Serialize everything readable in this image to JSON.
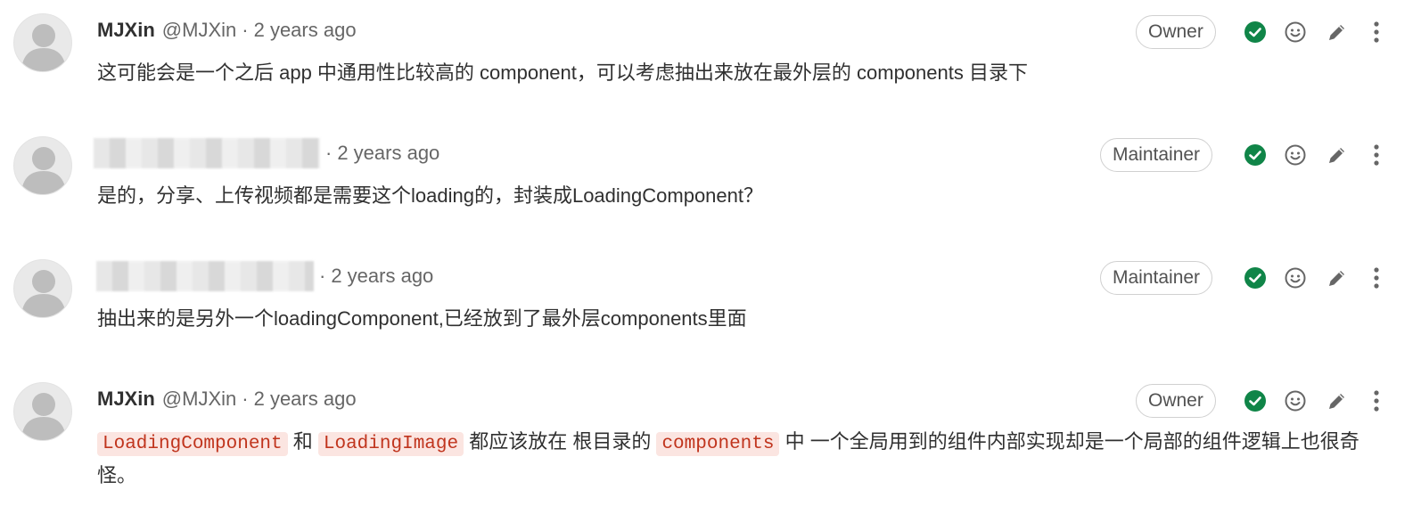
{
  "notes": [
    {
      "author_name": "MJXin",
      "author_handle": "@MJXin",
      "separator": "·",
      "time": "2 years ago",
      "role": "Owner",
      "body": "这可能会是一个之后 app 中通用性比较高的 component，可以考虑抽出来放在最外层的 components 目录下"
    },
    {
      "author_name": "",
      "author_handle": "",
      "separator": "·",
      "time": "2 years ago",
      "role": "Maintainer",
      "body": "是的，分享、上传视频都是需要这个loading的，封装成LoadingComponent？"
    },
    {
      "author_name": "",
      "author_handle": "",
      "separator": "·",
      "time": "2 years ago",
      "role": "Maintainer",
      "body": "抽出来的是另外一个loadingComponent,已经放到了最外层components里面"
    },
    {
      "author_name": "MJXin",
      "author_handle": "@MJXin",
      "separator": "·",
      "time": "2 years ago",
      "role": "Owner",
      "body_parts": {
        "code1": "LoadingComponent",
        "text1": " 和 ",
        "code2": "LoadingImage",
        "text2": " 都应该放在 根目录的 ",
        "code3": "components",
        "text3": " 中 一个全局用到的组件内部实现却是一个局部的组件逻辑上也很奇怪。"
      }
    }
  ],
  "icons": {
    "resolve": "check-circle-icon",
    "reaction": "smiley-icon",
    "edit": "pencil-icon",
    "more": "kebab-icon",
    "avatar": "default-avatar-icon"
  },
  "colors": {
    "resolve_green": "#108548",
    "code_text": "#c0341d",
    "code_bg": "#fbe5e1",
    "muted_text": "#666666"
  }
}
